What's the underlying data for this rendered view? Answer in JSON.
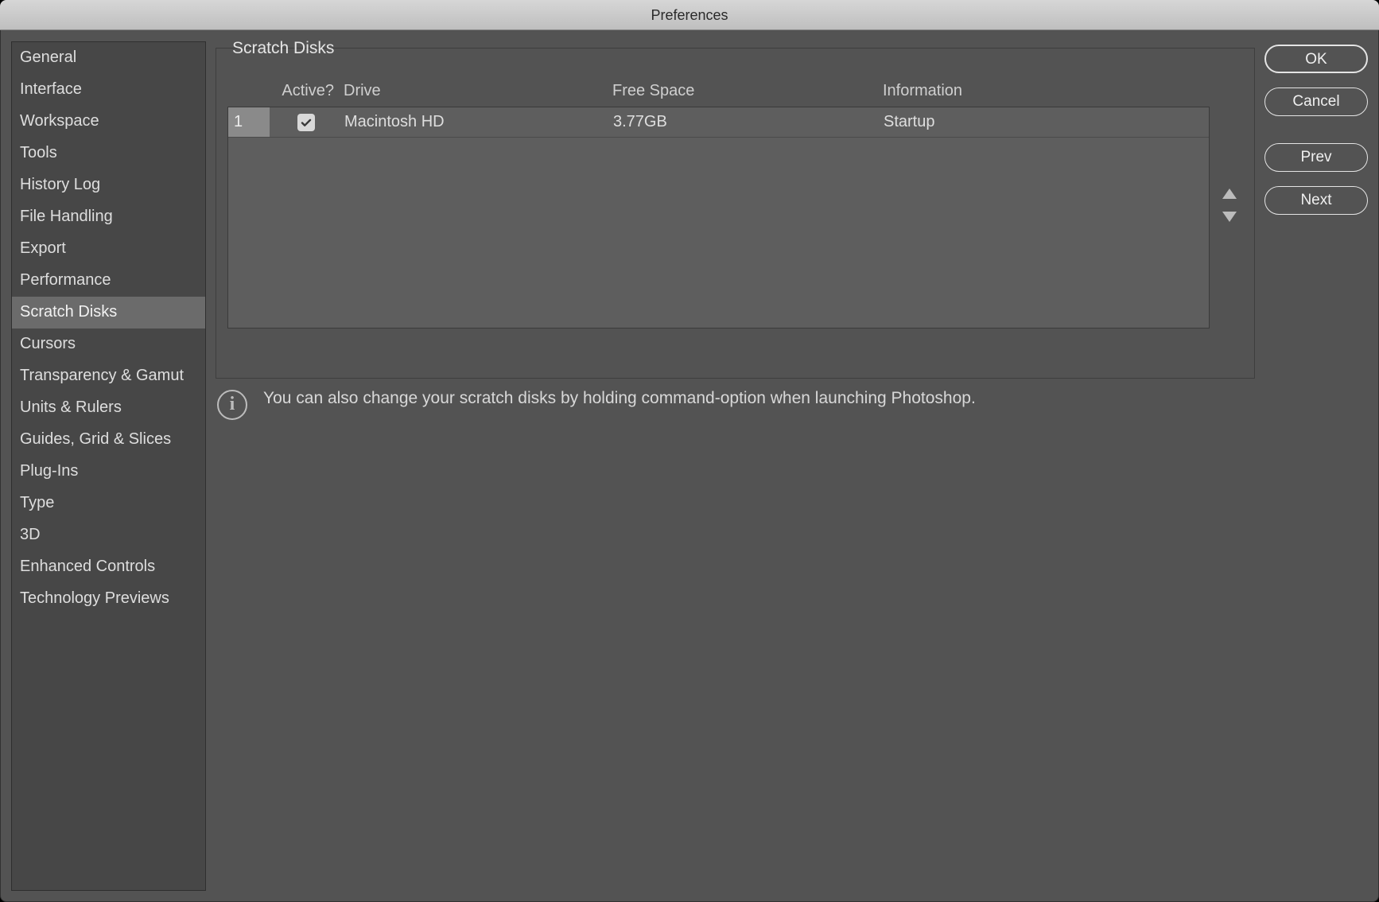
{
  "window": {
    "title": "Preferences"
  },
  "sidebar": {
    "items": [
      {
        "label": "General"
      },
      {
        "label": "Interface"
      },
      {
        "label": "Workspace"
      },
      {
        "label": "Tools"
      },
      {
        "label": "History Log"
      },
      {
        "label": "File Handling"
      },
      {
        "label": "Export"
      },
      {
        "label": "Performance"
      },
      {
        "label": "Scratch Disks"
      },
      {
        "label": "Cursors"
      },
      {
        "label": "Transparency & Gamut"
      },
      {
        "label": "Units & Rulers"
      },
      {
        "label": "Guides, Grid & Slices"
      },
      {
        "label": "Plug-Ins"
      },
      {
        "label": "Type"
      },
      {
        "label": "3D"
      },
      {
        "label": "Enhanced Controls"
      },
      {
        "label": "Technology Previews"
      }
    ],
    "selected_index": 8
  },
  "panel": {
    "title": "Scratch Disks",
    "columns": {
      "active": "Active?",
      "drive": "Drive",
      "free": "Free Space",
      "info": "Information"
    },
    "rows": [
      {
        "num": "1",
        "active": true,
        "drive": "Macintosh HD",
        "free": "3.77GB",
        "info": "Startup"
      }
    ],
    "hint": "You can also change your scratch disks by holding command-option when launching Photoshop."
  },
  "buttons": {
    "ok": "OK",
    "cancel": "Cancel",
    "prev": "Prev",
    "next": "Next"
  }
}
